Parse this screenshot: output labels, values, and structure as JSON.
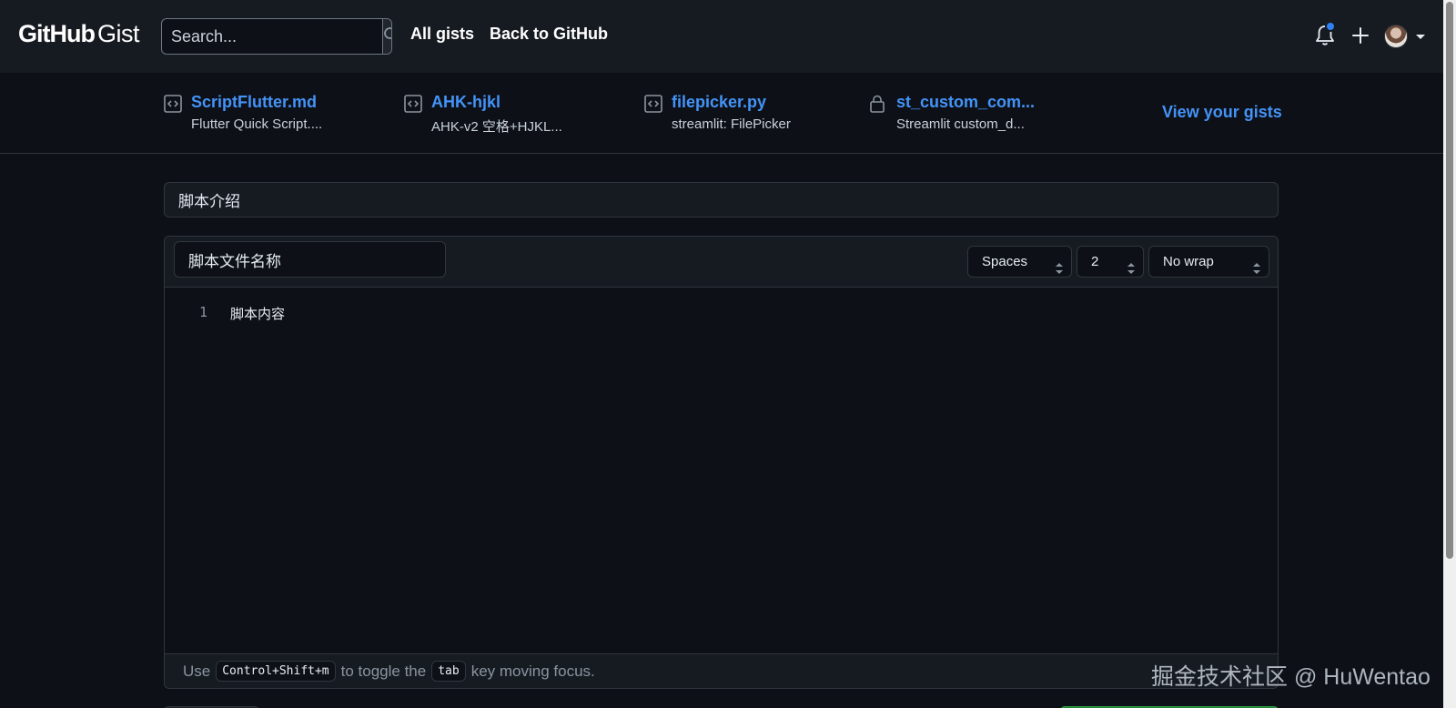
{
  "header": {
    "logo_github": "GitHub",
    "logo_gist": "Gist",
    "search_placeholder": "Search...",
    "nav": [
      "All gists",
      "Back to GitHub"
    ]
  },
  "recent_gists": [
    {
      "title": "ScriptFlutter.md",
      "desc": "Flutter Quick Script....",
      "icon": "code-square-icon"
    },
    {
      "title": "AHK-hjkl",
      "desc": "AHK-v2 空格+HJKL...",
      "icon": "code-square-icon"
    },
    {
      "title": "filepicker.py",
      "desc": "streamlit: FilePicker",
      "icon": "code-square-icon"
    },
    {
      "title": "st_custom_com...",
      "desc": "Streamlit custom_d...",
      "icon": "lock-icon"
    }
  ],
  "view_your_gists": "View your gists",
  "form": {
    "description_value": "脚本介绍",
    "filename_value": "脚本文件名称",
    "indent_mode": "Spaces",
    "indent_size": "2",
    "wrap_mode": "No wrap",
    "editor_lines": [
      {
        "num": "1",
        "text": "脚本内容"
      }
    ],
    "footer": {
      "use": "Use",
      "shortcut": "Control+Shift+m",
      "to_toggle": "to toggle the",
      "tab_key": "tab",
      "key_moving": "key moving focus."
    }
  },
  "watermark": "掘金技术社区 @ HuWentao",
  "colors": {
    "background": "#0d1117",
    "header": "#161b22",
    "link": "#4493f8",
    "notification_dot": "#2f81f7"
  }
}
